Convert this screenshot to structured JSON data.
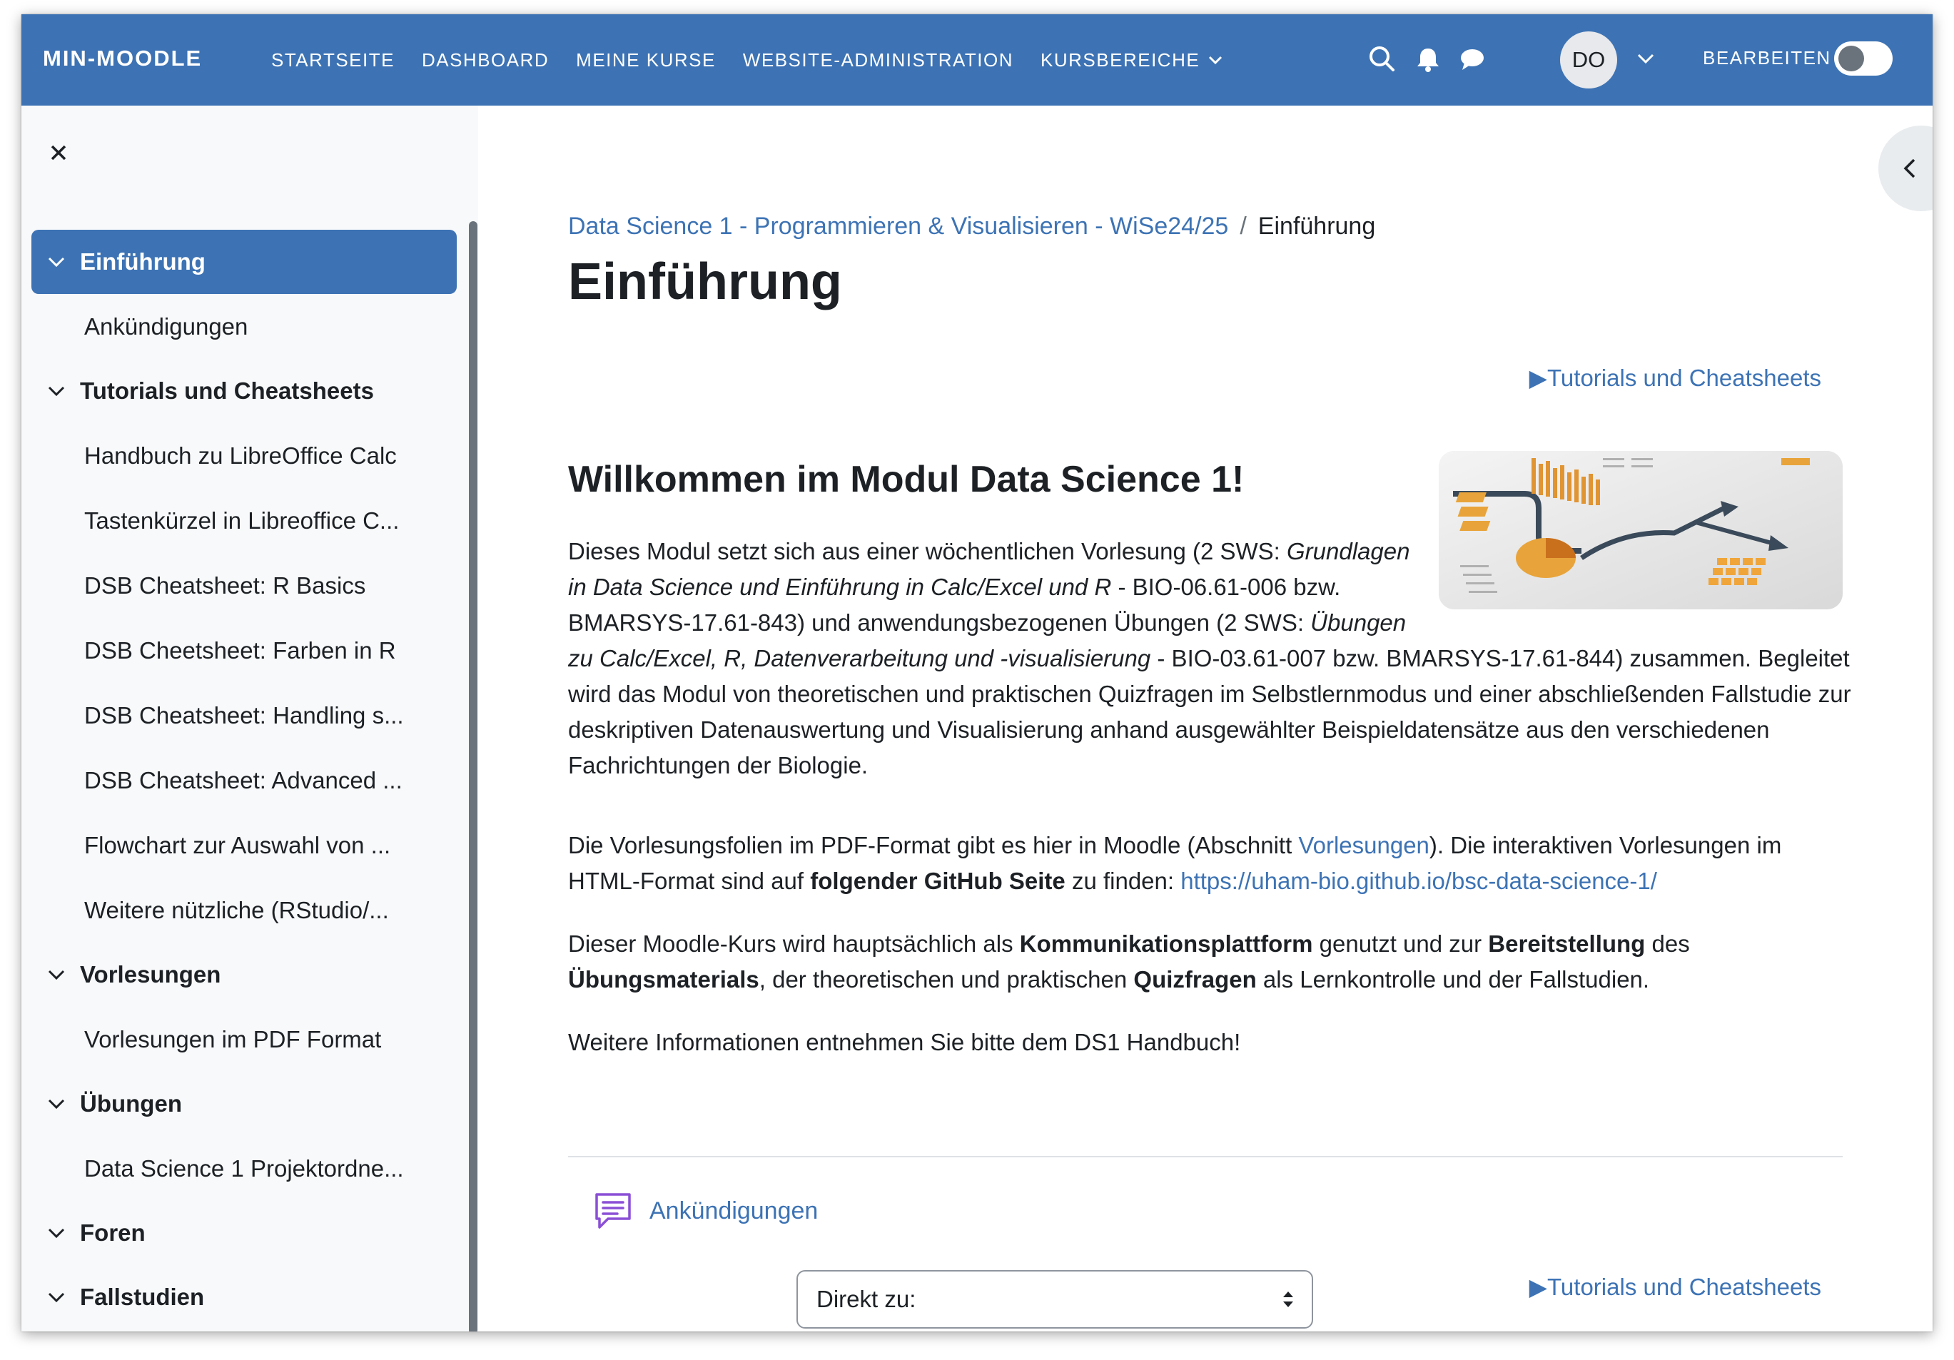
{
  "navbar": {
    "brand": "MIN-MOODLE",
    "links": [
      "STARTSEITE",
      "DASHBOARD",
      "MEINE KURSE",
      "WEBSITE-ADMINISTRATION",
      "KURSBEREICHE"
    ],
    "avatar_initials": "DO",
    "edit_label": "BEARBEITEN",
    "edit_mode": false
  },
  "sidebar": {
    "groups": [
      {
        "label": "Einführung",
        "active": true,
        "items": [
          "Ankündigungen"
        ]
      },
      {
        "label": "Tutorials und Cheatsheets",
        "active": false,
        "items": [
          "Handbuch zu LibreOffice Calc",
          "Tastenkürzel in Libreoffice C...",
          "DSB Cheatsheet: R Basics",
          "DSB Cheetsheet: Farben in R",
          "DSB Cheatsheet: Handling s...",
          "DSB Cheatsheet: Advanced ...",
          "Flowchart zur Auswahl von ...",
          "Weitere nützliche (RStudio/..."
        ]
      },
      {
        "label": "Vorlesungen",
        "active": false,
        "items": [
          "Vorlesungen im PDF Format"
        ]
      },
      {
        "label": "Übungen",
        "active": false,
        "items": [
          "Data Science 1 Projektordne..."
        ]
      },
      {
        "label": "Foren",
        "active": false,
        "items": []
      },
      {
        "label": "Fallstudien",
        "active": false,
        "items": []
      }
    ]
  },
  "breadcrumb": {
    "course": "Data Science 1 - Programmieren & Visualisieren - WiSe24/25",
    "separator": "/",
    "current": "Einführung"
  },
  "page_title": "Einführung",
  "next_link_top": "▶Tutorials und Cheatsheets",
  "next_link_bottom": "▶Tutorials und Cheatsheets",
  "content": {
    "heading": "Willkommen im Modul Data Science 1!",
    "p1": {
      "t1": "Dieses Modul setzt sich aus einer wöchentlichen Vorlesung (2 SWS: ",
      "i1": "Grundlagen in Data Science und Einführung in Calc/Excel und R",
      "t2": " -  BIO-06.61-006 bzw. BMARSYS-17.61-843) und anwendungsbezogenen Übungen (2 SWS: ",
      "i2": "Übungen zu Calc/Excel, R, Datenverarbeitung und -visualisierung",
      "t3": " - BIO-03.61-007 bzw. BMARSYS-17.61-844) zusammen. Begleitet wird das Modul von theoretischen und praktischen Quizfragen im Selbstlernmodus und einer abschließenden Fallstudie zur deskriptiven Datenauswertung und Visualisierung anhand ausgewählter Beispieldatensätze aus den verschiedenen Fachrichtungen der Biologie."
    },
    "p2": {
      "t1": "Die Vorlesungsfolien im PDF-Format gibt es hier in Moodle (Abschnitt ",
      "link1": "Vorlesungen",
      "t2": "). Die interaktiven Vorlesungen im HTML-Format sind auf ",
      "b1": "folgender GitHub Seite",
      "t3": " zu finden: ",
      "link2": "https://uham-bio.github.io/bsc-data-science-1/"
    },
    "p3": {
      "t1": "Dieser Moodle-Kurs wird hauptsächlich als ",
      "b1": "Kommunikationsplattform",
      "t2": " genutzt und zur ",
      "b2": "Bereitstellung",
      "t3": " des ",
      "b3": "Übungsmaterials",
      "t4": ", der theoretischen und praktischen ",
      "b4": "Quizfragen",
      "t5": " als Lernkontrolle und der Fallstudien."
    },
    "p4": "Weitere Informationen entnehmen Sie bitte dem DS1 Handbuch!"
  },
  "activity": {
    "label": "Ankündigungen"
  },
  "jump_select": {
    "value": "Direkt zu:"
  },
  "colors": {
    "primary": "#3d73b4",
    "sidebar_bg": "#f8f9fa",
    "text": "#1d2125"
  }
}
